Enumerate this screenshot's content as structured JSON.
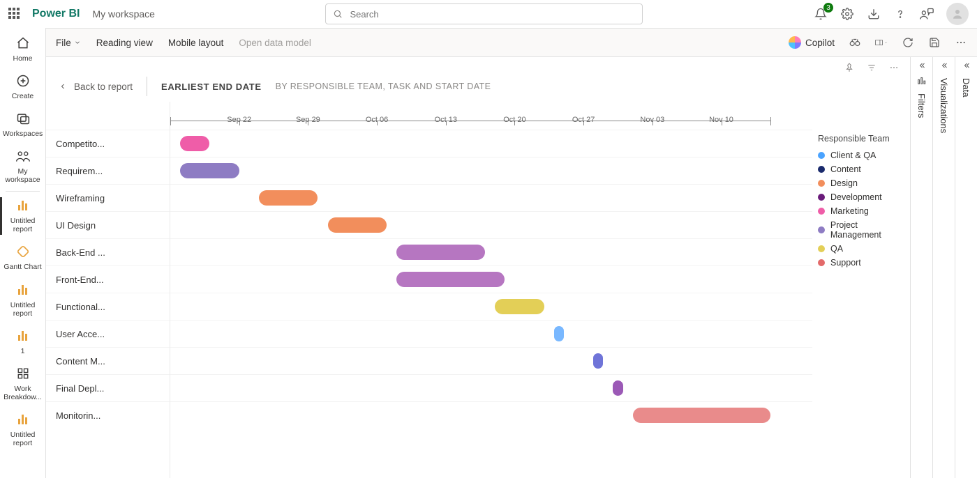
{
  "header": {
    "brand": "Power BI",
    "workspace_name": "My workspace",
    "search_placeholder": "Search",
    "notification_count": "3"
  },
  "leftnav": {
    "items": [
      {
        "id": "home",
        "label": "Home"
      },
      {
        "id": "create",
        "label": "Create"
      },
      {
        "id": "workspaces",
        "label": "Workspaces"
      },
      {
        "id": "my-ws",
        "label": "My workspace"
      },
      {
        "id": "untitled1",
        "label": "Untitled report",
        "active": true
      },
      {
        "id": "ganttchart",
        "label": "Gantt Chart"
      },
      {
        "id": "untitled2",
        "label": "Untitled report"
      },
      {
        "id": "one",
        "label": "1"
      },
      {
        "id": "wbs",
        "label": "Work Breakdow..."
      },
      {
        "id": "untitled3",
        "label": "Untitled report"
      }
    ]
  },
  "cmdbar": {
    "file": "File",
    "reading_view": "Reading view",
    "mobile_layout": "Mobile layout",
    "open_data_model": "Open data model",
    "copilot": "Copilot"
  },
  "visual": {
    "back_label": "Back to report",
    "title": "EARLIEST END DATE",
    "subtitle": "BY RESPONSIBLE TEAM, TASK AND START DATE"
  },
  "legend": {
    "title": "Responsible Team",
    "items": [
      {
        "label": "Client & QA",
        "color": "#4aa3ff"
      },
      {
        "label": "Content",
        "color": "#1a2a6c"
      },
      {
        "label": "Design",
        "color": "#f28e5c"
      },
      {
        "label": "Development",
        "color": "#6a1b7a"
      },
      {
        "label": "Marketing",
        "color": "#ef5da8"
      },
      {
        "label": "Project Management",
        "color": "#8e7cc3"
      },
      {
        "label": "QA",
        "color": "#e3cf57"
      },
      {
        "label": "Support",
        "color": "#e36a6a"
      }
    ]
  },
  "chart_data": {
    "type": "bar",
    "orientation": "gantt",
    "x_axis": {
      "type": "date",
      "min": "2024-09-15",
      "max": "2024-11-15"
    },
    "axis_ticks": [
      "Sep 22",
      "Sep 29",
      "Oct 06",
      "Oct 13",
      "Oct 20",
      "Oct 27",
      "Nov 03",
      "Nov 10"
    ],
    "tasks": [
      {
        "label": "Competito...",
        "team": "Marketing",
        "start": "2024-09-16",
        "end": "2024-09-19",
        "color": "#ef5da8"
      },
      {
        "label": "Requirem...",
        "team": "Project Management",
        "start": "2024-09-16",
        "end": "2024-09-22",
        "color": "#8e7cc3"
      },
      {
        "label": "Wireframing",
        "team": "Design",
        "start": "2024-09-24",
        "end": "2024-09-30",
        "color": "#f28e5c"
      },
      {
        "label": "UI Design",
        "team": "Design",
        "start": "2024-10-01",
        "end": "2024-10-07",
        "color": "#f28e5c"
      },
      {
        "label": "Back-End ...",
        "team": "Development",
        "start": "2024-10-08",
        "end": "2024-10-17",
        "color": "#b676c1"
      },
      {
        "label": "Front-End...",
        "team": "Development",
        "start": "2024-10-08",
        "end": "2024-10-19",
        "color": "#b676c1"
      },
      {
        "label": "Functional...",
        "team": "QA",
        "start": "2024-10-18",
        "end": "2024-10-23",
        "color": "#e3cf57"
      },
      {
        "label": "User Acce...",
        "team": "Client & QA",
        "start": "2024-10-24",
        "end": "2024-10-25",
        "color": "#79b8ff"
      },
      {
        "label": "Content M...",
        "team": "Content",
        "start": "2024-10-28",
        "end": "2024-10-29",
        "color": "#6f74d8"
      },
      {
        "label": "Final Depl...",
        "team": "Development",
        "start": "2024-10-30",
        "end": "2024-10-31",
        "color": "#9b59b6"
      },
      {
        "label": "Monitorin...",
        "team": "Support",
        "start": "2024-11-01",
        "end": "2024-11-15",
        "color": "#e98b8b"
      }
    ]
  },
  "panes": {
    "filters": "Filters",
    "visualizations": "Visualizations",
    "data": "Data"
  }
}
